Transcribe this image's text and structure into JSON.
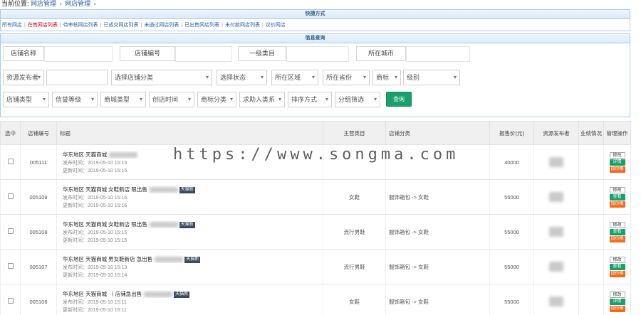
{
  "breadcrumb": {
    "current_label": "当前位置:",
    "items": [
      "网店管理",
      "网店管理"
    ]
  },
  "shortcut": {
    "title": "快捷方式",
    "links": [
      {
        "label": "所有网店",
        "red": false
      },
      {
        "label": "在售网店列表",
        "red": true
      },
      {
        "label": "待审核网店列表",
        "red": false
      },
      {
        "label": "已成交网店列表",
        "red": false
      },
      {
        "label": "未通过网店列表",
        "red": false
      },
      {
        "label": "已出售网店列表",
        "red": false
      },
      {
        "label": "未付款网店列表",
        "red": false
      },
      {
        "label": "议价网店",
        "red": false
      }
    ]
  },
  "query": {
    "title": "信息查询",
    "row1": [
      "店铺名称",
      "店铺编号",
      "一级类目",
      "所在城市"
    ],
    "row2": [
      {
        "label": "资源发布者",
        "dropdown": true
      },
      {
        "label": "",
        "dropdown": false
      },
      {
        "label": "选择店铺分类",
        "dropdown": true
      },
      {
        "label": "选择状态",
        "dropdown": true
      },
      {
        "label": "所在区域",
        "dropdown": true
      },
      {
        "label": "所在省份",
        "dropdown": true
      },
      {
        "label": "商标",
        "dropdown": true
      },
      {
        "label": "级别",
        "dropdown": true
      }
    ],
    "row3": [
      {
        "label": "店铺类型",
        "dropdown": true
      },
      {
        "label": "信誉等级",
        "dropdown": true
      },
      {
        "label": "商城类型",
        "dropdown": true
      },
      {
        "label": "创店时间",
        "dropdown": true
      },
      {
        "label": "商标分类",
        "dropdown": true
      },
      {
        "label": "求助人类系",
        "dropdown": true
      },
      {
        "label": "排序方式",
        "dropdown": true
      },
      {
        "label": "分组筛选",
        "dropdown": true
      }
    ],
    "submit_label": "查询"
  },
  "table": {
    "headers": [
      "选中",
      "店铺编号",
      "标题",
      "主营类目",
      "店铺分类",
      "报售价(元)",
      "资源发布者",
      "业绩情况",
      "管理操作"
    ],
    "rows": [
      {
        "id": "005111",
        "title": "华东地区 天猫商城",
        "tag": "",
        "publish": "发布时间：2019-05-10 15:15",
        "update": "更新时间：2019-05-10 15:15",
        "category": "",
        "shop_class": "",
        "price": "40000",
        "ops": [
          "修改",
          "详情",
          "加价格"
        ]
      },
      {
        "id": "005109",
        "title": "华东地区 天猫商城 女鞋新店 限出售",
        "tag": "天猫新",
        "publish": "发布时间：2019-05-10 15:16",
        "update": "更新时间：2019-05-10 15:16",
        "category": "女鞋",
        "shop_class": "服饰箱包 -> 女鞋",
        "price": "55000",
        "ops": [
          "修改",
          "查看",
          "加价格"
        ]
      },
      {
        "id": "005108",
        "title": "华东地区 天猫商城 女鞋新店 限出售",
        "tag": "天猫新",
        "publish": "发布时间：2019-05-10 15:15",
        "update": "更新时间：2019-05-10 15:15",
        "category": "流行男鞋",
        "shop_class": "服饰箱包 -> 女鞋",
        "price": "55000",
        "ops": [
          "修改",
          "查看",
          "加价格"
        ]
      },
      {
        "id": "005107",
        "title": "华东地区 天猫商城 男女鞋新店 急出售",
        "tag": "天猫新",
        "publish": "发布时间：2019-05-10 15:13",
        "update": "更新时间：2019-05-10 15:14",
        "category": "流行男鞋",
        "shop_class": "服饰箱包 -> 女鞋",
        "price": "55000",
        "ops": [
          "修改",
          "查看",
          "加价格"
        ]
      },
      {
        "id": "005106",
        "title": "华东地区 天猫商城 （ 店铺急出售",
        "tag": "天猫新",
        "publish": "发布时间：2019-05-10 15:11",
        "update": "更新时间：2019-05-10 15:11",
        "category": "女鞋",
        "shop_class": "服饰箱包 -> 女鞋",
        "price": "55000",
        "ops": [
          "修改",
          "详情",
          "加价格"
        ]
      }
    ]
  },
  "watermark": "https://www.songma.com"
}
